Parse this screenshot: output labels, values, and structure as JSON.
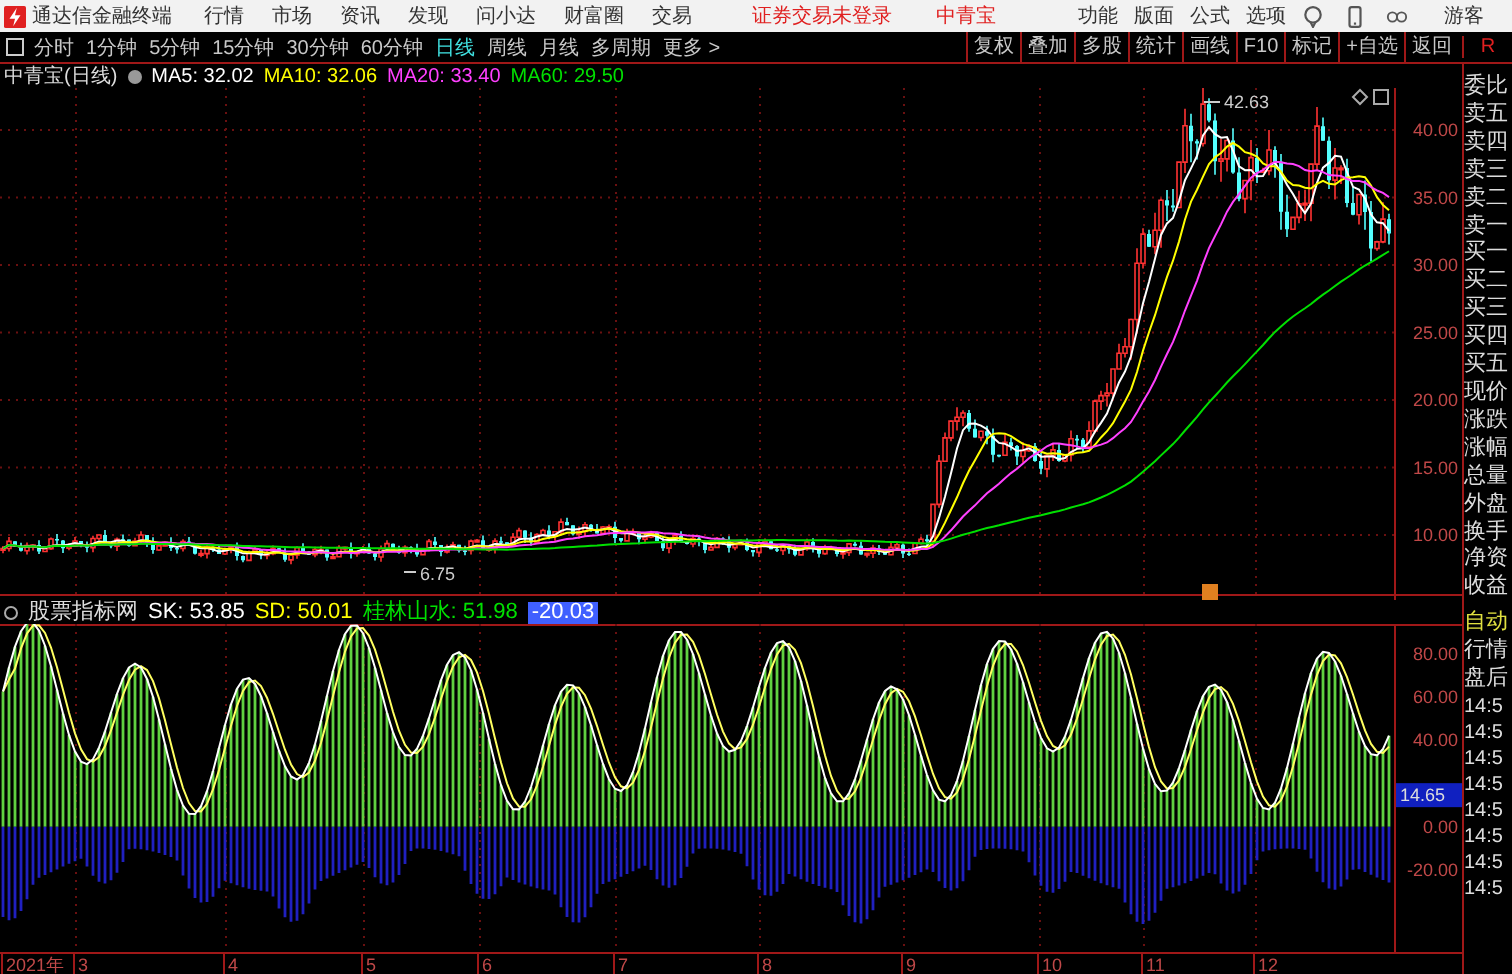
{
  "app": {
    "title": "通达信金融终端",
    "menus": [
      "行情",
      "市场",
      "资讯",
      "发现",
      "问小达",
      "财富圈",
      "交易"
    ],
    "login_status": "证券交易未登录",
    "stock": "中青宝",
    "right_menus": [
      "功能",
      "版面",
      "公式",
      "选项"
    ],
    "user": "游客"
  },
  "toolbar": {
    "periods": [
      {
        "label": "分时",
        "selected": false
      },
      {
        "label": "1分钟",
        "selected": false
      },
      {
        "label": "5分钟",
        "selected": false
      },
      {
        "label": "15分钟",
        "selected": false
      },
      {
        "label": "30分钟",
        "selected": false
      },
      {
        "label": "60分钟",
        "selected": false
      },
      {
        "label": "日线",
        "selected": true
      },
      {
        "label": "周线",
        "selected": false
      },
      {
        "label": "月线",
        "selected": false
      },
      {
        "label": "多周期",
        "selected": false
      },
      {
        "label": "更多 >",
        "selected": false
      }
    ],
    "actions": [
      "复权",
      "叠加",
      "多股",
      "统计",
      "画线",
      "F10",
      "标记",
      "+自选",
      "返回"
    ],
    "corner": "R"
  },
  "chart": {
    "title": "中青宝(日线)",
    "ma": [
      {
        "label": "MA5: 32.02",
        "color": "#ffffff"
      },
      {
        "label": "MA10: 32.06",
        "color": "#ffff00"
      },
      {
        "label": "MA20: 33.40",
        "color": "#ff40ff"
      },
      {
        "label": "MA60: 29.50",
        "color": "#00e000"
      }
    ],
    "high_label": "42.63",
    "low_label": "6.75",
    "y_labels": [
      "40.00",
      "35.00",
      "30.00",
      "25.00",
      "20.00",
      "15.00",
      "10.00"
    ]
  },
  "indicator": {
    "name": "股票指标网",
    "readings": [
      {
        "label": "SK: 53.85",
        "color": "#ffffff",
        "kind": "plain"
      },
      {
        "label": "SD: 50.01",
        "color": "#ffff00",
        "kind": "plain"
      },
      {
        "label": "桂林山水: 51.98",
        "color": "#00e000",
        "kind": "plain"
      },
      {
        "label": "-20.03",
        "color": "#4060ff",
        "kind": "boxed"
      }
    ],
    "y_labels": [
      {
        "label": "80.00",
        "kind": "tick"
      },
      {
        "label": "60.00",
        "kind": "tick"
      },
      {
        "label": "40.00",
        "kind": "tick"
      },
      {
        "label": "14.65",
        "kind": "current"
      },
      {
        "label": "0.00",
        "kind": "tick"
      },
      {
        "label": "-20.00",
        "kind": "tick"
      }
    ]
  },
  "quote_panel": {
    "labels": [
      "委比",
      "卖五",
      "卖四",
      "卖三",
      "卖二",
      "卖一",
      "买一",
      "买二",
      "买三",
      "买四",
      "买五",
      "现价",
      "涨跌",
      "涨幅",
      "总量",
      "外盘",
      "换手",
      "净资",
      "收益"
    ],
    "mode": "自动",
    "tabs": [
      "行情",
      "盘后"
    ],
    "times": [
      "14:5",
      "14:5",
      "14:5",
      "14:5",
      "14:5",
      "14:5",
      "14:5",
      "14:5"
    ]
  },
  "x_axis": [
    "2021年",
    "3",
    "4",
    "5",
    "6",
    "7",
    "8",
    "9",
    "10",
    "11",
    "12"
  ]
}
